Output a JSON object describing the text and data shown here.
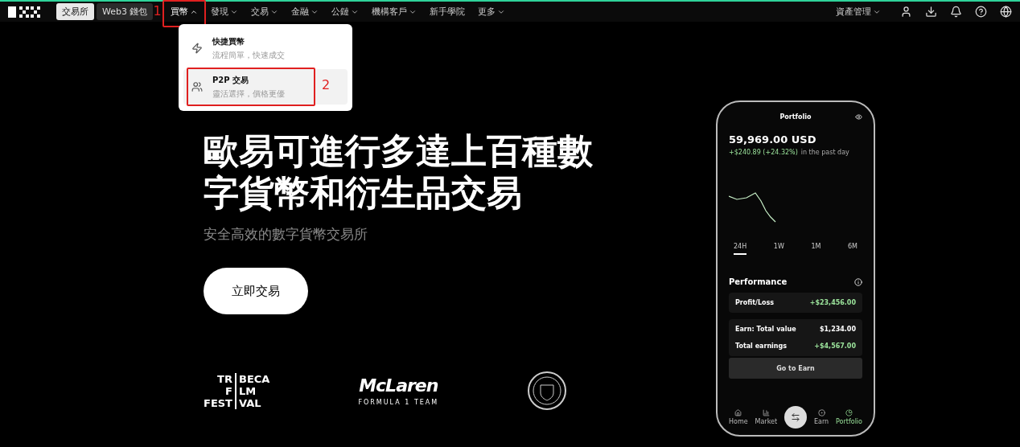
{
  "top_bar": {
    "tabs": [
      {
        "label": "交易所",
        "selected": true
      },
      {
        "label": "Web3 錢包",
        "selected": false
      }
    ],
    "nav": [
      {
        "label": "買幣",
        "caret": true,
        "open": true,
        "annotation": "1"
      },
      {
        "label": "發現",
        "caret": true,
        "open": false
      },
      {
        "label": "交易",
        "caret": true,
        "open": false
      },
      {
        "label": "金融",
        "caret": true,
        "open": false
      },
      {
        "label": "公鏈",
        "caret": true,
        "open": false
      },
      {
        "label": "機構客戶",
        "caret": true,
        "open": false
      },
      {
        "label": "新手學院",
        "caret": false,
        "open": false
      },
      {
        "label": "更多",
        "caret": true,
        "open": false
      }
    ],
    "assets_menu": "資產管理"
  },
  "dropdown": {
    "items": [
      {
        "kind": "quick",
        "title": "快捷買幣",
        "subtitle": "流程簡單，快速成交",
        "selected": false
      },
      {
        "kind": "p2p",
        "title": "P2P 交易",
        "subtitle": "靈活選擇，價格更優",
        "selected": true,
        "annotation": "2"
      }
    ]
  },
  "hero": {
    "heading": "歐易可進行多達上百種數字貨幣和衍生品交易",
    "subtitle": "安全高效的數字貨幣交易所",
    "button": "立即交易"
  },
  "partners": {
    "tribeca": [
      [
        "TR",
        "BECA"
      ],
      [
        "F",
        "LM"
      ],
      [
        "FEST",
        "VAL"
      ]
    ],
    "mclaren": "McLaren",
    "mclaren_sub": "FORMULA 1 TEAM"
  },
  "phone": {
    "title": "Portfolio",
    "balance": "59,969.00 USD",
    "change": "+$240.89 (+24.32%)",
    "change_note": "in the past day",
    "ranges": [
      {
        "label": "24H",
        "selected": true
      },
      {
        "label": "1W",
        "selected": false
      },
      {
        "label": "1M",
        "selected": false
      },
      {
        "label": "6M",
        "selected": false
      }
    ],
    "performance_title": "Performance",
    "cards": [
      {
        "rows": [
          {
            "label": "Profit/Loss",
            "value": "+$23,456.00",
            "positive": true
          }
        ]
      },
      {
        "rows": [
          {
            "label": "Earn: Total value",
            "value": "$1,234.00",
            "positive": false
          },
          {
            "label": "Total earnings",
            "value": "+$4,567.00",
            "positive": true
          }
        ]
      }
    ],
    "earn_button": "Go to Earn",
    "tabs": [
      {
        "kind": "home",
        "label": "Home",
        "selected": false
      },
      {
        "kind": "market",
        "label": "Market",
        "selected": false
      },
      {
        "kind": "trade"
      },
      {
        "kind": "earn",
        "label": "Earn",
        "selected": false
      },
      {
        "kind": "portfolio",
        "label": "Portfolio",
        "selected": true
      }
    ]
  }
}
